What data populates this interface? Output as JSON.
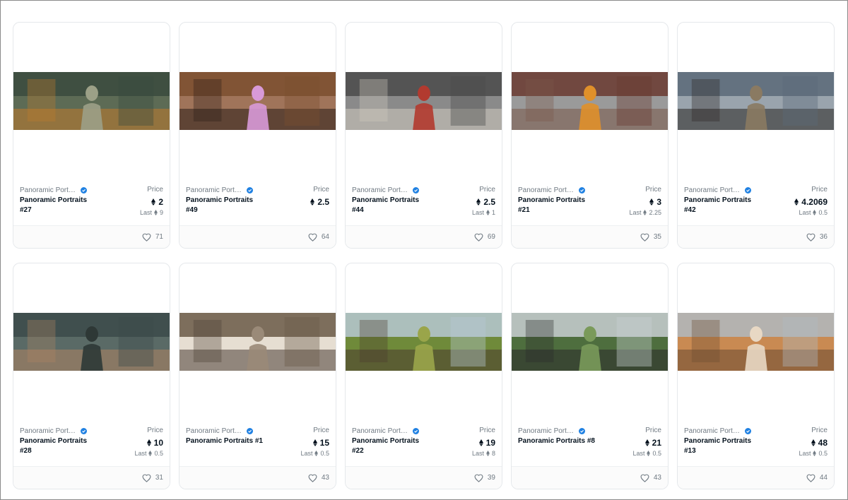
{
  "items": [
    {
      "collection": "Panoramic Portraits",
      "name": "Panoramic Portraits #27",
      "price_label": "Price",
      "price": "2",
      "last_label": "Last",
      "last": "9",
      "likes": "71",
      "colors": [
        "#3a4a3e",
        "#5d6b55",
        "#9ca087",
        "#c07a2c"
      ]
    },
    {
      "collection": "Panoramic Portraits",
      "name": "Panoramic Portraits #49",
      "price_label": "Price",
      "price": "2.5",
      "last_label": "",
      "last": "",
      "likes": "64",
      "colors": [
        "#7b4f2f",
        "#a0745a",
        "#d89ad8",
        "#2a1e18"
      ]
    },
    {
      "collection": "Panoramic Portraits",
      "name": "Panoramic Portraits #44",
      "price_label": "Price",
      "price": "2.5",
      "last_label": "Last",
      "last": "1",
      "likes": "69",
      "colors": [
        "#4a4a4a",
        "#8a8a8a",
        "#b23a2f",
        "#d0cbc0"
      ]
    },
    {
      "collection": "Panoramic Portraits",
      "name": "Panoramic Portraits #21",
      "price_label": "Price",
      "price": "3",
      "last_label": "Last",
      "last": "2.25",
      "likes": "35",
      "colors": [
        "#6a3a30",
        "#9a9a9a",
        "#e0902a",
        "#7a5a4a"
      ]
    },
    {
      "collection": "Panoramic Portraits",
      "name": "Panoramic Portraits #42",
      "price_label": "Price",
      "price": "4.2069",
      "last_label": "Last",
      "last": "0.5",
      "likes": "36",
      "colors": [
        "#5b6a78",
        "#9aa4ad",
        "#8a7a62",
        "#2a2622"
      ]
    },
    {
      "collection": "Panoramic Portraits",
      "name": "Panoramic Portraits #28",
      "price_label": "Price",
      "price": "10",
      "last_label": "Last",
      "last": "0.5",
      "likes": "31",
      "colors": [
        "#3c4a4a",
        "#5a6a66",
        "#2e3836",
        "#b08462"
      ]
    },
    {
      "collection": "Panoramic Portraits",
      "name": "Panoramic Portraits #1",
      "price_label": "Price",
      "price": "15",
      "last_label": "Last",
      "last": "0.5",
      "likes": "43",
      "colors": [
        "#6a5a48",
        "#e6ded2",
        "#9a8a78",
        "#4a3e34"
      ]
    },
    {
      "collection": "Panoramic Portraits",
      "name": "Panoramic Portraits #22",
      "price_label": "Price",
      "price": "19",
      "last_label": "Last",
      "last": "8",
      "likes": "39",
      "colors": [
        "#b7c8d4",
        "#6f8a3a",
        "#9aa54a",
        "#4a3a2e"
      ]
    },
    {
      "collection": "Panoramic Portraits",
      "name": "Panoramic Portraits #8",
      "price_label": "Price",
      "price": "21",
      "last_label": "Last",
      "last": "0.5",
      "likes": "43",
      "colors": [
        "#c9cfd2",
        "#4e6e3e",
        "#7a9a5a",
        "#2a2a2a"
      ]
    },
    {
      "collection": "Panoramic Portraits",
      "name": "Panoramic Portraits #13",
      "price_label": "Price",
      "price": "48",
      "last_label": "Last",
      "last": "0.5",
      "likes": "44",
      "colors": [
        "#b0b8c0",
        "#c98a52",
        "#e8d8c4",
        "#6a4a32"
      ]
    }
  ]
}
